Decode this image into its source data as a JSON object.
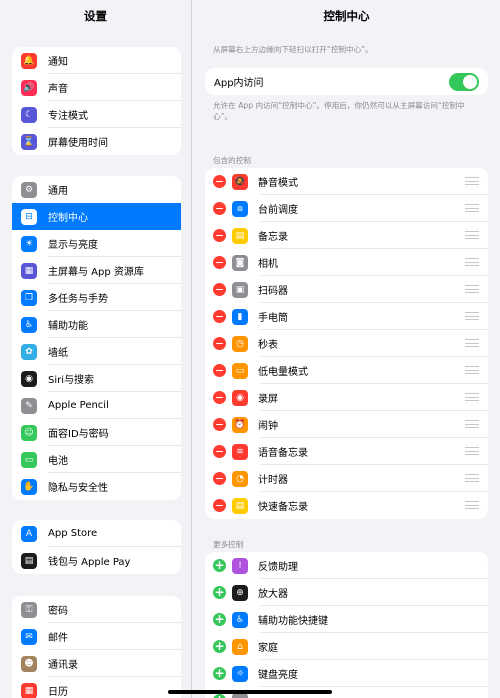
{
  "sidebar": {
    "title": "设置",
    "groups": [
      [
        {
          "label": "通知",
          "icon": "bell-icon",
          "color": "#ff3b30",
          "glyph": "🔔"
        },
        {
          "label": "声音",
          "icon": "speaker-icon",
          "color": "#ff2d55",
          "glyph": "🔊"
        },
        {
          "label": "专注模式",
          "icon": "moon-icon",
          "color": "#5856d6",
          "glyph": "☾"
        },
        {
          "label": "屏幕使用时间",
          "icon": "hourglass-icon",
          "color": "#5856d6",
          "glyph": "⌛"
        }
      ],
      [
        {
          "label": "通用",
          "icon": "gear-icon",
          "color": "#8e8e93",
          "glyph": "⚙"
        },
        {
          "label": "控制中心",
          "icon": "toggles-icon",
          "color": "#8e8e93",
          "glyph": "⊟",
          "selected": true
        },
        {
          "label": "显示与亮度",
          "icon": "sun-icon",
          "color": "#007aff",
          "glyph": "☀"
        },
        {
          "label": "主屏幕与 App 资源库",
          "icon": "home-grid-icon",
          "color": "#5856d6",
          "glyph": "▦"
        },
        {
          "label": "多任务与手势",
          "icon": "multitask-icon",
          "color": "#007aff",
          "glyph": "❐"
        },
        {
          "label": "辅助功能",
          "icon": "accessibility-icon",
          "color": "#007aff",
          "glyph": "♿"
        },
        {
          "label": "墙纸",
          "icon": "flower-icon",
          "color": "#32ade6",
          "glyph": "✿"
        },
        {
          "label": "Siri与搜索",
          "icon": "siri-icon",
          "color": "#1c1c1e",
          "glyph": "◉"
        },
        {
          "label": "Apple Pencil",
          "icon": "pencil-icon",
          "color": "#8e8e93",
          "glyph": "✎"
        },
        {
          "label": "面容ID与密码",
          "icon": "faceid-icon",
          "color": "#34c759",
          "glyph": "☺"
        },
        {
          "label": "电池",
          "icon": "battery-icon",
          "color": "#34c759",
          "glyph": "▭"
        },
        {
          "label": "隐私与安全性",
          "icon": "hand-icon",
          "color": "#007aff",
          "glyph": "✋"
        }
      ],
      [
        {
          "label": "App Store",
          "icon": "appstore-icon",
          "color": "#007aff",
          "glyph": "A"
        },
        {
          "label": "钱包与 Apple Pay",
          "icon": "wallet-icon",
          "color": "#1c1c1e",
          "glyph": "▤"
        }
      ],
      [
        {
          "label": "密码",
          "icon": "key-icon",
          "color": "#8e8e93",
          "glyph": "⚿"
        },
        {
          "label": "邮件",
          "icon": "mail-icon",
          "color": "#007aff",
          "glyph": "✉"
        },
        {
          "label": "通讯录",
          "icon": "contacts-icon",
          "color": "#a2845e",
          "glyph": "☻"
        },
        {
          "label": "日历",
          "icon": "calendar-icon",
          "color": "#ff3b30",
          "glyph": "▦"
        }
      ]
    ]
  },
  "main": {
    "title": "控制中心",
    "top_hint": "从屏幕右上方边缘向下轻扫以打开“控制中心”。",
    "access_label": "App内访问",
    "access_on": true,
    "access_hint": "允许在 App 内访问“控制中心”。停用后，你仍然可以从主屏幕访问“控制中心”。",
    "included_header": "包含的控制",
    "included": [
      {
        "label": "静音模式",
        "icon": "bell-slash-icon",
        "color": "#ff3b30",
        "glyph": "🔕"
      },
      {
        "label": "台前调度",
        "icon": "stage-manager-icon",
        "color": "#007aff",
        "glyph": "⧈"
      },
      {
        "label": "备忘录",
        "icon": "notes-icon",
        "color": "#ffcc00",
        "glyph": "▤"
      },
      {
        "label": "相机",
        "icon": "camera-icon",
        "color": "#8e8e93",
        "glyph": "◙"
      },
      {
        "label": "扫码器",
        "icon": "qr-icon",
        "color": "#8e8e93",
        "glyph": "▣"
      },
      {
        "label": "手电筒",
        "icon": "flashlight-icon",
        "color": "#007aff",
        "glyph": "▮"
      },
      {
        "label": "秒表",
        "icon": "stopwatch-icon",
        "color": "#ff9500",
        "glyph": "◷"
      },
      {
        "label": "低电量模式",
        "icon": "low-power-icon",
        "color": "#ff9500",
        "glyph": "▭"
      },
      {
        "label": "录屏",
        "icon": "record-icon",
        "color": "#ff3b30",
        "glyph": "◉"
      },
      {
        "label": "闹钟",
        "icon": "alarm-icon",
        "color": "#ff9500",
        "glyph": "⏰"
      },
      {
        "label": "语音备忘录",
        "icon": "waveform-icon",
        "color": "#ff3b30",
        "glyph": "≋"
      },
      {
        "label": "计时器",
        "icon": "timer-icon",
        "color": "#ff9500",
        "glyph": "◔"
      },
      {
        "label": "快速备忘录",
        "icon": "quick-note-icon",
        "color": "#ffcc00",
        "glyph": "▤"
      }
    ],
    "more_header": "更多控制",
    "more": [
      {
        "label": "反馈助理",
        "icon": "feedback-icon",
        "color": "#af52de",
        "glyph": "!"
      },
      {
        "label": "放大器",
        "icon": "magnifier-icon",
        "color": "#1c1c1e",
        "glyph": "⊕"
      },
      {
        "label": "辅助功能快捷键",
        "icon": "accessibility-shortcut-icon",
        "color": "#007aff",
        "glyph": "♿"
      },
      {
        "label": "家庭",
        "icon": "house-icon",
        "color": "#ff9500",
        "glyph": "⌂"
      },
      {
        "label": "键盘亮度",
        "icon": "keyboard-brightness-icon",
        "color": "#007aff",
        "glyph": "☼"
      },
      {
        "label": "",
        "icon": "partial-row-icon",
        "color": "#8e8e93",
        "glyph": ""
      }
    ]
  }
}
